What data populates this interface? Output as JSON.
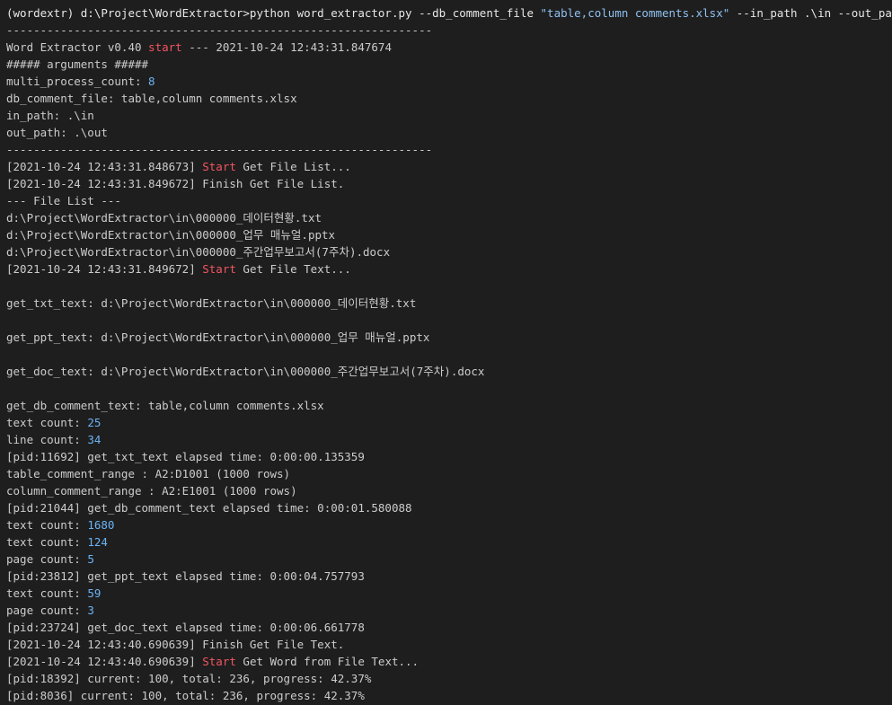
{
  "terminal": {
    "colors": {
      "background": "#1e1e1e",
      "text": "#cccccc",
      "string": "#8fc1f0",
      "keyword_red": "#f25561",
      "number": "#6bb3f5"
    },
    "lines": [
      [
        {
          "t": "(wordextr) d:\\Project\\WordExtractor>python word_extractor.py --db_comment_file ",
          "c": "cmd"
        },
        {
          "t": "\"table,column comments.xlsx\"",
          "c": "str"
        },
        {
          "t": " --in_path .\\in --out_path .\\out",
          "c": "cmd"
        }
      ],
      [
        {
          "t": "---------------------------------------------------------------",
          "c": ""
        }
      ],
      [
        {
          "t": "Word Extractor v0.40 ",
          "c": ""
        },
        {
          "t": "start",
          "c": "red"
        },
        {
          "t": " --- 2021-10-24 12:43:31.847674",
          "c": ""
        }
      ],
      [
        {
          "t": "##### arguments #####",
          "c": ""
        }
      ],
      [
        {
          "t": "multi_process_count: ",
          "c": ""
        },
        {
          "t": "8",
          "c": "num"
        }
      ],
      [
        {
          "t": "db_comment_file: table,column comments.xlsx",
          "c": ""
        }
      ],
      [
        {
          "t": "in_path: .\\in",
          "c": ""
        }
      ],
      [
        {
          "t": "out_path: .\\out",
          "c": ""
        }
      ],
      [
        {
          "t": "---------------------------------------------------------------",
          "c": ""
        }
      ],
      [
        {
          "t": "[2021-10-24 12:43:31.848673] ",
          "c": ""
        },
        {
          "t": "Start",
          "c": "red"
        },
        {
          "t": " Get File List...",
          "c": ""
        }
      ],
      [
        {
          "t": "[2021-10-24 12:43:31.849672] Finish Get File List.",
          "c": ""
        }
      ],
      [
        {
          "t": "--- File List ---",
          "c": ""
        }
      ],
      [
        {
          "t": "d:\\Project\\WordExtractor\\in\\000000_데이터현황.txt",
          "c": ""
        }
      ],
      [
        {
          "t": "d:\\Project\\WordExtractor\\in\\000000_업무 매뉴얼.pptx",
          "c": ""
        }
      ],
      [
        {
          "t": "d:\\Project\\WordExtractor\\in\\000000_주간업무보고서(7주차).docx",
          "c": ""
        }
      ],
      [
        {
          "t": "[2021-10-24 12:43:31.849672] ",
          "c": ""
        },
        {
          "t": "Start",
          "c": "red"
        },
        {
          "t": " Get File Text...",
          "c": ""
        }
      ],
      [
        {
          "t": "",
          "c": ""
        }
      ],
      [
        {
          "t": "get_txt_text: d:\\Project\\WordExtractor\\in\\000000_데이터현황.txt",
          "c": ""
        }
      ],
      [
        {
          "t": "",
          "c": ""
        }
      ],
      [
        {
          "t": "get_ppt_text: d:\\Project\\WordExtractor\\in\\000000_업무 매뉴얼.pptx",
          "c": ""
        }
      ],
      [
        {
          "t": "",
          "c": ""
        }
      ],
      [
        {
          "t": "get_doc_text: d:\\Project\\WordExtractor\\in\\000000_주간업무보고서(7주차).docx",
          "c": ""
        }
      ],
      [
        {
          "t": "",
          "c": ""
        }
      ],
      [
        {
          "t": "get_db_comment_text: table,column comments.xlsx",
          "c": ""
        }
      ],
      [
        {
          "t": "text count: ",
          "c": ""
        },
        {
          "t": "25",
          "c": "num"
        }
      ],
      [
        {
          "t": "line count: ",
          "c": ""
        },
        {
          "t": "34",
          "c": "num"
        }
      ],
      [
        {
          "t": "[pid:11692] get_txt_text elapsed time: 0:00:00.135359",
          "c": ""
        }
      ],
      [
        {
          "t": "table_comment_range : A2:D1001 (1000 rows)",
          "c": ""
        }
      ],
      [
        {
          "t": "column_comment_range : A2:E1001 (1000 rows)",
          "c": ""
        }
      ],
      [
        {
          "t": "[pid:21044] get_db_comment_text elapsed time: 0:00:01.580088",
          "c": ""
        }
      ],
      [
        {
          "t": "text count: ",
          "c": ""
        },
        {
          "t": "1680",
          "c": "num"
        }
      ],
      [
        {
          "t": "text count: ",
          "c": ""
        },
        {
          "t": "124",
          "c": "num"
        }
      ],
      [
        {
          "t": "page count: ",
          "c": ""
        },
        {
          "t": "5",
          "c": "num"
        }
      ],
      [
        {
          "t": "[pid:23812] get_ppt_text elapsed time: 0:00:04.757793",
          "c": ""
        }
      ],
      [
        {
          "t": "text count: ",
          "c": ""
        },
        {
          "t": "59",
          "c": "num"
        }
      ],
      [
        {
          "t": "page count: ",
          "c": ""
        },
        {
          "t": "3",
          "c": "num"
        }
      ],
      [
        {
          "t": "[pid:23724] get_doc_text elapsed time: 0:00:06.661778",
          "c": ""
        }
      ],
      [
        {
          "t": "[2021-10-24 12:43:40.690639] Finish Get File Text.",
          "c": ""
        }
      ],
      [
        {
          "t": "[2021-10-24 12:43:40.690639] ",
          "c": ""
        },
        {
          "t": "Start",
          "c": "red"
        },
        {
          "t": " Get Word from File Text...",
          "c": ""
        }
      ],
      [
        {
          "t": "[pid:18392] current: 100, total: 236, progress: 42.37%",
          "c": ""
        }
      ],
      [
        {
          "t": "[pid:8036] current: 100, total: 236, progress: 42.37%",
          "c": ""
        }
      ]
    ]
  }
}
